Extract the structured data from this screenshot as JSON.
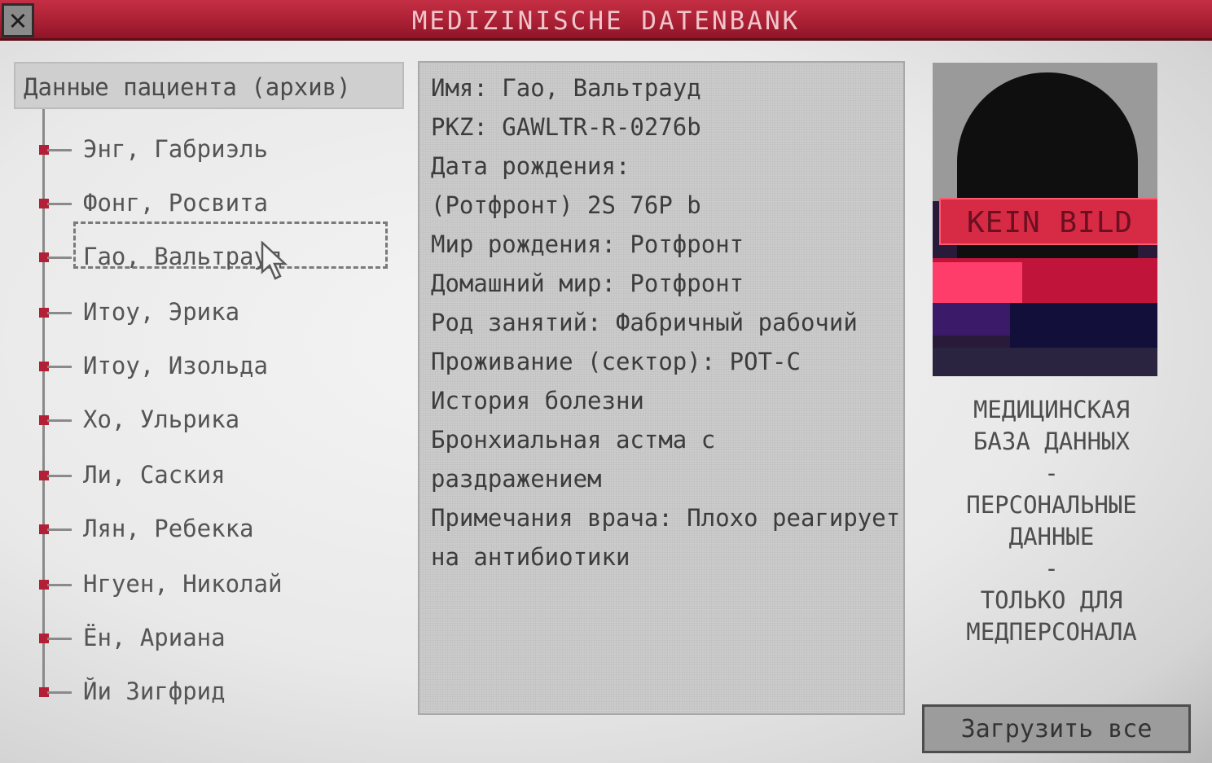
{
  "window": {
    "title": "MEDIZINISCHE DATENBANK",
    "close_label": "✕"
  },
  "tree": {
    "header": "Данные пациента (архив)",
    "items": [
      {
        "label": "Энг, Габриэль"
      },
      {
        "label": "Фонг, Росвита"
      },
      {
        "label": "Гао, Вальтрауд",
        "selected": true
      },
      {
        "label": "Итоу, Эрика"
      },
      {
        "label": "Итоу, Изольда"
      },
      {
        "label": "Хо, Ульрика"
      },
      {
        "label": "Ли, Саския"
      },
      {
        "label": "Лян, Ребекка"
      },
      {
        "label": "Нгуен, Николай"
      },
      {
        "label": "Ён, Ариана"
      },
      {
        "label": "Йи Зигфрид"
      }
    ]
  },
  "record": {
    "name": "Имя: Гао, Вальтрауд",
    "pkz": "PKZ: GAWLTR-R-0276b",
    "birth_date_label": "Дата рождения:",
    "birth_date_value": "(Ротфронт) 2S 76P b",
    "birth_world": "Мир рождения: Ротфронт",
    "home_world": "Домашний мир: Ротфронт",
    "occupation": "Род занятий: Фабричный рабочий",
    "residence": "Проживание (сектор): РОТ-С",
    "history_label": "История болезни",
    "history_line1": "Бронхиальная астма с",
    "history_line2": "раздражением",
    "notes_line1": "Примечания врача: Плохо реагирует",
    "notes_line2": "на антибиотики"
  },
  "photo": {
    "placeholder": "KEIN BILD"
  },
  "side": {
    "line1": "МЕДИЦИНСКАЯ",
    "line2": "БАЗА ДАННЫХ",
    "sep1": "-",
    "line3": "ПЕРСОНАЛЬНЫЕ",
    "line4": "ДАННЫЕ",
    "sep2": "-",
    "line5": "ТОЛЬКО ДЛЯ",
    "line6": "МЕДПЕРСОНАЛА"
  },
  "actions": {
    "load_all": "Загрузить все"
  },
  "colors": {
    "titlebar": "#a81f33",
    "node": "#b21f36"
  }
}
